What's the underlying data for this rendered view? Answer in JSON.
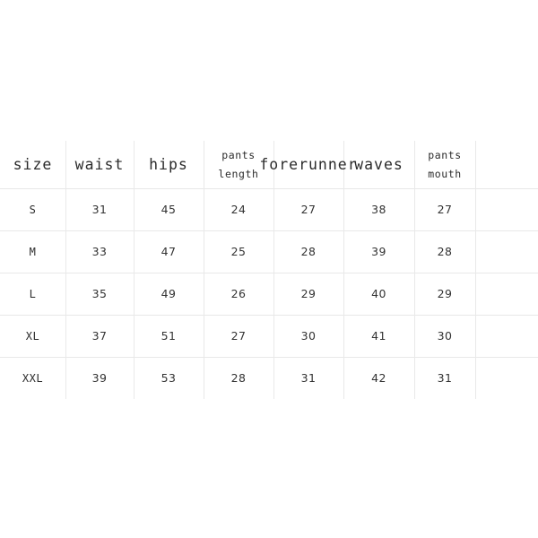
{
  "table": {
    "name": "size-chart",
    "columns": [
      {
        "key": "size",
        "label": "size",
        "label_line1": "size",
        "label_line2": "",
        "multiline": false
      },
      {
        "key": "waist",
        "label": "waist",
        "label_line1": "waist",
        "label_line2": "",
        "multiline": false
      },
      {
        "key": "hips",
        "label": "hips",
        "label_line1": "hips",
        "label_line2": "",
        "multiline": false
      },
      {
        "key": "pants_length",
        "label": "pants length",
        "label_line1": "pants",
        "label_line2": "length",
        "multiline": true
      },
      {
        "key": "forerunner",
        "label": "forerunner",
        "label_line1": "forerunner",
        "label_line2": "",
        "multiline": false
      },
      {
        "key": "waves",
        "label": "waves",
        "label_line1": "waves",
        "label_line2": "",
        "multiline": false
      },
      {
        "key": "pants_mouth",
        "label": "pants mouth",
        "label_line1": "pants",
        "label_line2": "mouth",
        "multiline": true
      }
    ],
    "rows": [
      {
        "size": "S",
        "waist": "31",
        "hips": "45",
        "pants_length": "24",
        "forerunner": "27",
        "waves": "38",
        "pants_mouth": "27"
      },
      {
        "size": "M",
        "waist": "33",
        "hips": "47",
        "pants_length": "25",
        "forerunner": "28",
        "waves": "39",
        "pants_mouth": "28"
      },
      {
        "size": "L",
        "waist": "35",
        "hips": "49",
        "pants_length": "26",
        "forerunner": "29",
        "waves": "40",
        "pants_mouth": "29"
      },
      {
        "size": "XL",
        "waist": "37",
        "hips": "51",
        "pants_length": "27",
        "forerunner": "30",
        "waves": "41",
        "pants_mouth": "30"
      },
      {
        "size": "XXL",
        "waist": "39",
        "hips": "53",
        "pants_length": "28",
        "forerunner": "31",
        "waves": "42",
        "pants_mouth": "31"
      }
    ]
  },
  "style": {
    "background": "#ffffff",
    "grid_line_color": "#e8e8e8",
    "header_text_color": "#2b2b2b",
    "data_text_color": "#333333"
  }
}
